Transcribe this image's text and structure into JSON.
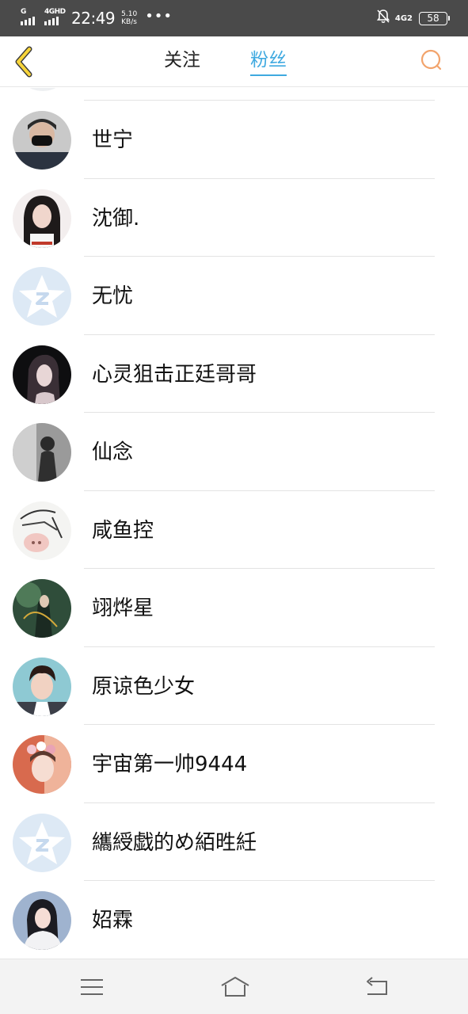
{
  "status_bar": {
    "sim1_label": "G",
    "sim2_label": "4GHD",
    "time": "22:49",
    "speed_value": "5.10",
    "speed_unit": "KB/s",
    "more": "•••",
    "network_label": "4G2",
    "battery": "58"
  },
  "header": {
    "tabs": [
      {
        "label": "关注",
        "active": false
      },
      {
        "label": "粉丝",
        "active": true
      }
    ],
    "accent_color": "#3fa9e0",
    "back_icon": "chevron-left-icon",
    "search_icon": "search-icon"
  },
  "fans": [
    {
      "name": "世宁",
      "avatar": "photo-masked-man"
    },
    {
      "name": "沈御.",
      "avatar": "photo-girl-long-hair"
    },
    {
      "name": "无忧",
      "avatar": "default-qzone-avatar"
    },
    {
      "name": "心灵狙击正廷哥哥",
      "avatar": "illustration-girl-dark"
    },
    {
      "name": "仙念",
      "avatar": "photo-grayscale-silhouette"
    },
    {
      "name": "咸鱼控",
      "avatar": "sketch-pig"
    },
    {
      "name": "翊烨星",
      "avatar": "illustration-fantasy-figure"
    },
    {
      "name": "原谅色少女",
      "avatar": "photo-young-man"
    },
    {
      "name": "宇宙第一帅9444",
      "avatar": "photo-flower-crown"
    },
    {
      "name": "纗綬戯的め絔甠紝",
      "avatar": "default-qzone-avatar"
    },
    {
      "name": "妱霖",
      "avatar": "photo-woman-white-dress"
    }
  ],
  "nav": {
    "menu_icon": "menu-icon",
    "home_icon": "home-icon",
    "back_icon": "back-arrow-icon"
  }
}
